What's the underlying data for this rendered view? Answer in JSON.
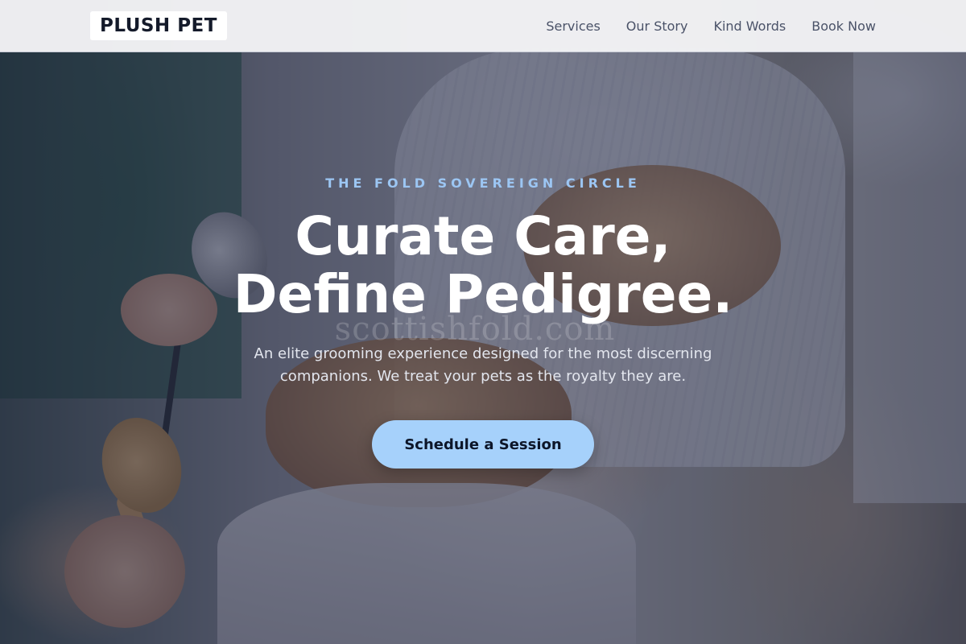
{
  "brand": {
    "logo_text": "PLUSH PET"
  },
  "nav": {
    "links": [
      {
        "label": "Services"
      },
      {
        "label": "Our Story"
      },
      {
        "label": "Kind Words"
      },
      {
        "label": "Book Now"
      }
    ]
  },
  "hero": {
    "eyebrow": "THE FOLD SOVEREIGN CIRCLE",
    "headline_line1": "Curate Care,",
    "headline_line2": "Define Pedigree.",
    "subtext": "An elite grooming experience designed for the most discerning companions. We treat your pets as the royalty they are.",
    "cta_label": "Schedule a Session",
    "watermark": "scottishfold.com"
  },
  "colors": {
    "accent": "#a6d1fb",
    "eyebrow": "#9cc6f3",
    "nav_text": "#4a5268",
    "logo_text": "#141a2a"
  }
}
